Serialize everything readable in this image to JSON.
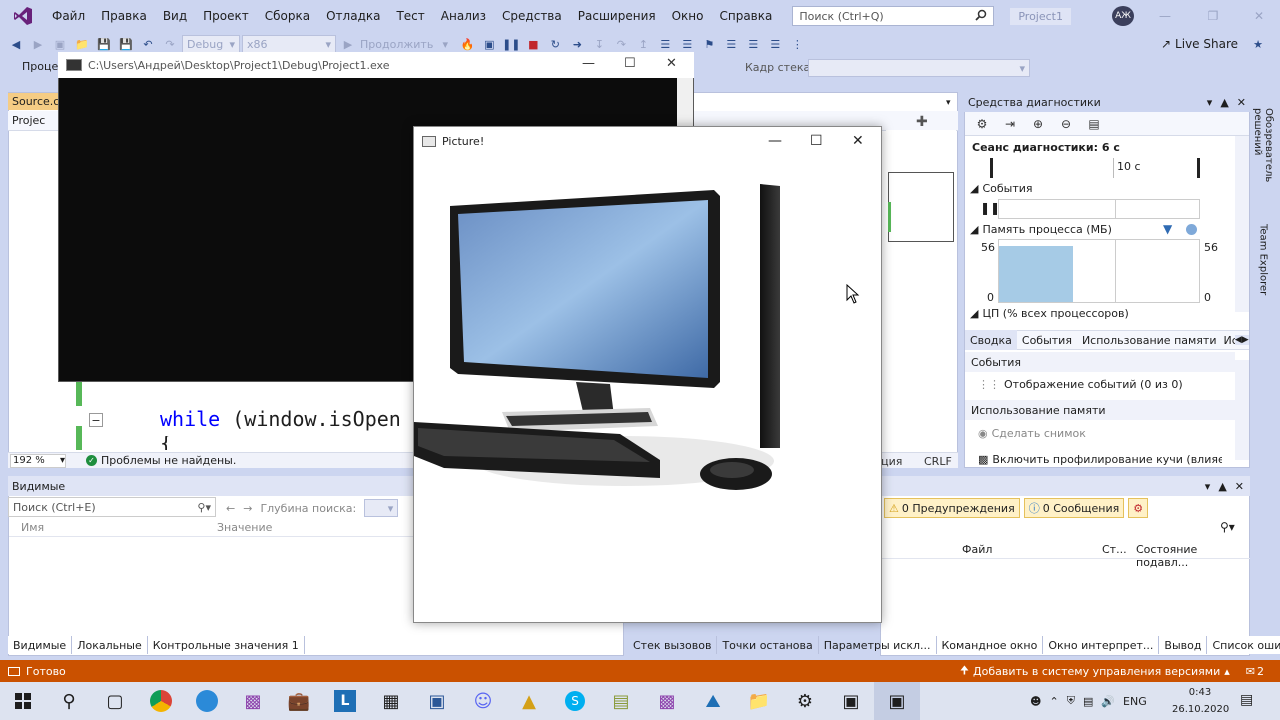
{
  "menu": {
    "items": [
      "Файл",
      "Правка",
      "Вид",
      "Проект",
      "Сборка",
      "Отладка",
      "Тест",
      "Анализ",
      "Средства",
      "Расширения",
      "Окно",
      "Справка"
    ],
    "search_placeholder": "Поиск (Ctrl+Q)",
    "project_badge": "Project1",
    "avatar": "АЖ"
  },
  "toolbar": {
    "config": "Debug",
    "platform": "x86",
    "continue_label": "Продолжить",
    "live_share": "Live Share",
    "stack_frame_label": "Кадр стека:",
    "process_label": "Проце"
  },
  "editor": {
    "tab_label": "Source.cp",
    "nav_label": "Projec",
    "code_keyword": "while",
    "code_rest": " (window.isOpen",
    "brace": "{",
    "zoom": "192 %",
    "issues": "Проблемы не найдены.",
    "pos_ln": "иция",
    "pos_crlf": "CRLF"
  },
  "console": {
    "title": "C:\\Users\\Андрей\\Desktop\\Project1\\Debug\\Project1.exe"
  },
  "picture_window": {
    "title": "Picture!"
  },
  "diagnostics": {
    "title": "Средства диагностики",
    "session": "Сеанс диагностики: 6 с",
    "timeline_tick": "10 с",
    "events_section": "События",
    "memory_section": "Память процесса (МБ)",
    "mem_max": "56",
    "mem_min": "0",
    "mem_fill_percent": 100,
    "cpu_section": "ЦП (% всех процессоров)",
    "tabs": [
      "Сводка",
      "События",
      "Использование памяти",
      "Ис"
    ],
    "events_header": "События",
    "events_item": "Отображение событий (0 из 0)",
    "memory_header": "Использование памяти",
    "snapshot": "Сделать снимок",
    "heap_profile": "Включить профилирование кучи (влияет на"
  },
  "side_tabs": {
    "solution_explorer": "Обозреватель решений",
    "team_explorer": "Team Explorer"
  },
  "watch": {
    "title": "Видимые",
    "search_placeholder": "Поиск (Ctrl+E)",
    "depth_label": "Глубина поиска:",
    "col_name": "Имя",
    "col_value": "Значение",
    "tabs": [
      "Видимые",
      "Локальные",
      "Контрольные значения 1"
    ]
  },
  "errors": {
    "warnings": "0 Предупреждения",
    "messages": "0 Сообщения",
    "col_file": "Файл",
    "col_line": "Ст...",
    "col_state": "Состояние подавл...",
    "tabs": [
      "Стек вызовов",
      "Точки останова",
      "Параметры искл...",
      "Командное окно",
      "Окно интерпрет...",
      "Вывод",
      "Список ошибок"
    ]
  },
  "statusbar": {
    "ready": "Готово",
    "add_vcs": "Добавить в систему управления версиями",
    "notifications": "2"
  },
  "taskbar": {
    "lang": "ENG",
    "time": "0:43",
    "date": "26.10.2020"
  }
}
